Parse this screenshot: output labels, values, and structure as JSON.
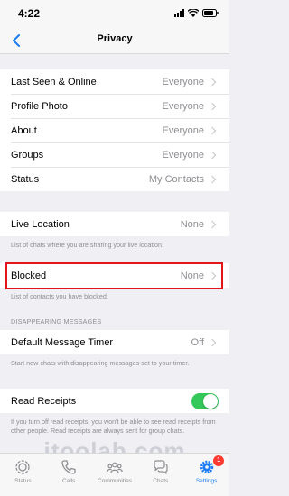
{
  "status_bar": {
    "time": "4:22"
  },
  "nav": {
    "title": "Privacy"
  },
  "group1": [
    {
      "label": "Last Seen & Online",
      "value": "Everyone"
    },
    {
      "label": "Profile Photo",
      "value": "Everyone"
    },
    {
      "label": "About",
      "value": "Everyone"
    },
    {
      "label": "Groups",
      "value": "Everyone"
    },
    {
      "label": "Status",
      "value": "My Contacts"
    }
  ],
  "live_location": {
    "label": "Live Location",
    "value": "None",
    "footnote": "List of chats where you are sharing your live location."
  },
  "blocked": {
    "label": "Blocked",
    "value": "None",
    "footnote": "List of contacts you have blocked."
  },
  "disappearing": {
    "header": "DISAPPEARING MESSAGES",
    "label": "Default Message Timer",
    "value": "Off",
    "footnote": "Start new chats with disappearing messages set to your timer."
  },
  "read_receipts": {
    "label": "Read Receipts",
    "enabled": true,
    "footnote": "If you turn off read receipts, you won't be able to see read receipts from other people. Read receipts are always sent for group chats."
  },
  "tabs": [
    {
      "label": "Status",
      "icon": "status-icon",
      "active": false
    },
    {
      "label": "Calls",
      "icon": "phone-icon",
      "active": false
    },
    {
      "label": "Communities",
      "icon": "communities-icon",
      "active": false
    },
    {
      "label": "Chats",
      "icon": "chat-bubbles-icon",
      "active": false
    },
    {
      "label": "Settings",
      "icon": "gear-icon",
      "active": true,
      "badge": "1"
    }
  ],
  "watermark": "itoolab.com",
  "colors": {
    "accent": "#1c7cf4",
    "toggle_on": "#34c759",
    "highlight": "#e5141b",
    "badge": "#ff3b30"
  }
}
